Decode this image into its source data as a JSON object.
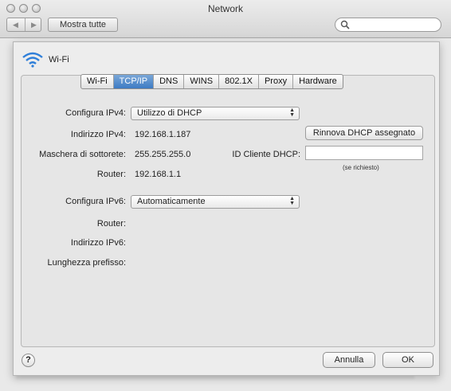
{
  "window": {
    "title": "Network"
  },
  "toolbar": {
    "back_icon": "chevron-left-icon",
    "forward_icon": "chevron-right-icon",
    "show_all_label": "Mostra tutte",
    "search_placeholder": ""
  },
  "sheet": {
    "interface_name": "Wi-Fi",
    "tabs": [
      {
        "label": "Wi-Fi",
        "active": false
      },
      {
        "label": "TCP/IP",
        "active": true
      },
      {
        "label": "DNS",
        "active": false
      },
      {
        "label": "WINS",
        "active": false
      },
      {
        "label": "802.1X",
        "active": false
      },
      {
        "label": "Proxy",
        "active": false
      },
      {
        "label": "Hardware",
        "active": false
      }
    ],
    "ipv4": {
      "configure_label": "Configura IPv4:",
      "configure_value": "Utilizzo di DHCP",
      "address_label": "Indirizzo IPv4:",
      "address_value": "192.168.1.187",
      "renew_button": "Rinnova DHCP assegnato",
      "subnet_label": "Maschera di sottorete:",
      "subnet_value": "255.255.255.0",
      "client_id_label": "ID Cliente DHCP:",
      "client_id_value": "",
      "client_id_note": "(se richiesto)",
      "router_label": "Router:",
      "router_value": "192.168.1.1"
    },
    "ipv6": {
      "configure_label": "Configura IPv6:",
      "configure_value": "Automaticamente",
      "router_label": "Router:",
      "address_label": "Indirizzo IPv6:",
      "prefix_label": "Lunghezza prefisso:"
    },
    "buttons": {
      "help": "?",
      "cancel": "Annulla",
      "ok": "OK"
    }
  },
  "colors": {
    "accent_tab": "#3d7bc4",
    "wifi_icon": "#2f7fd9"
  }
}
